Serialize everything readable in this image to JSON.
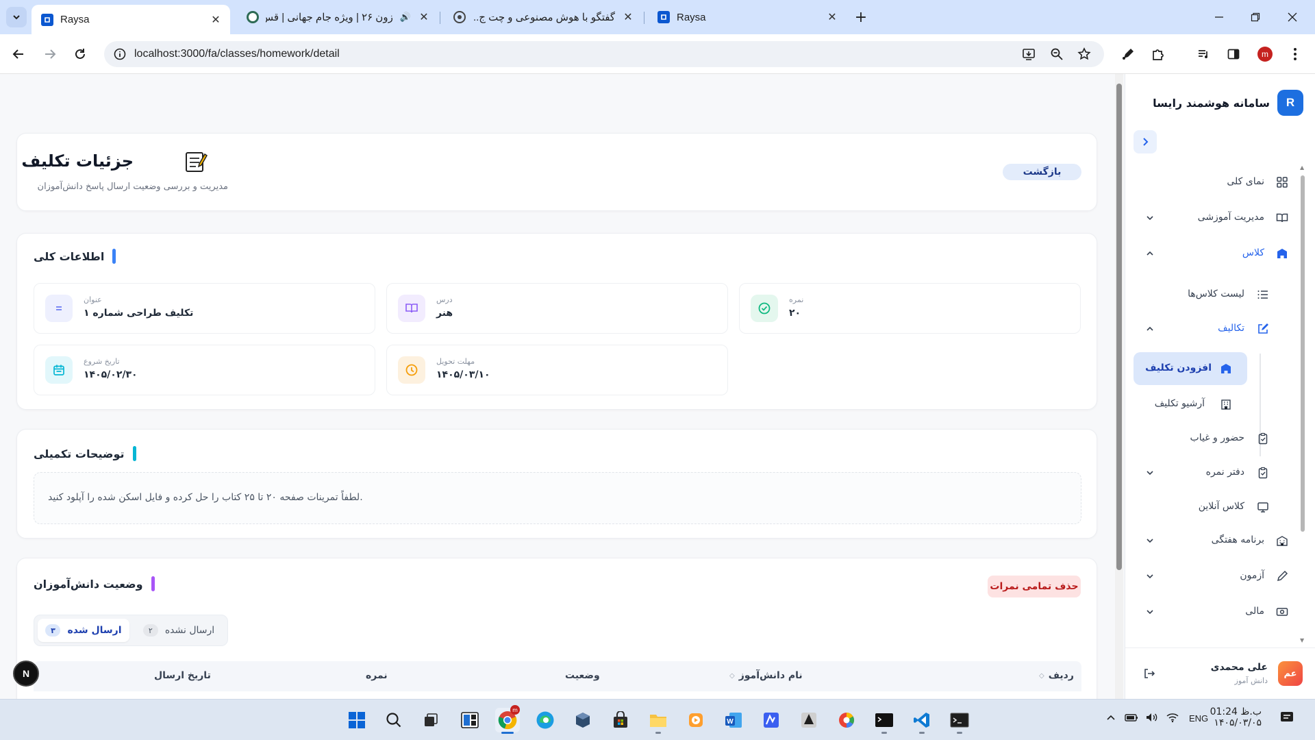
{
  "browser": {
    "tabs": [
      {
        "title": "Raysa",
        "active": true,
        "icon": "raysa-favicon"
      },
      {
        "title": "زون ۲۶ | ویژه جام جهانی | قس...",
        "active": false,
        "icon": "site-favicon",
        "audio": true
      },
      {
        "title": "گفتگو با هوش مصنوعی و چت ج...",
        "active": false,
        "icon": "chatgpt-favicon"
      },
      {
        "title": "Raysa",
        "active": false,
        "icon": "raysa-favicon"
      }
    ],
    "url": "localhost:3000/fa/classes/homework/detail",
    "profile_initial": "m"
  },
  "header": {
    "title": "جزئیات تکلیف",
    "subtitle": "مدیریت و بررسی وضعیت ارسال پاسخ دانش‌آموزان",
    "back_label": "بازگشت"
  },
  "general_info": {
    "title": "اطلاعات کلی",
    "fields": [
      {
        "label": "عنوان",
        "value": "تکلیف طراحی شماره ۱",
        "icon": "text-lines-icon",
        "color": "#6d7bf2",
        "bg": "#eef0fe"
      },
      {
        "label": "درس",
        "value": "هنر",
        "icon": "book-icon",
        "color": "#8b5cf6",
        "bg": "#f2ecfe"
      },
      {
        "label": "نمره",
        "value": "۲۰",
        "icon": "check-circle-icon",
        "color": "#10b981",
        "bg": "#e4f7ee"
      },
      {
        "label": "تاریخ شروع",
        "value": "۱۴۰۵/۰۲/۳۰",
        "icon": "calendar-icon",
        "color": "#06b6d4",
        "bg": "#e2f7fb"
      },
      {
        "label": "مهلت تحویل",
        "value": "۱۴۰۵/۰۳/۱۰",
        "icon": "clock-icon",
        "color": "#f59e0b",
        "bg": "#fdf1df"
      }
    ]
  },
  "extra": {
    "title": "توضیحات تکمیلی",
    "text": "لطفاً تمرینات صفحه ۲۰ تا ۲۵ کتاب را حل کرده و فایل اسکن شده را آپلود کنید."
  },
  "students": {
    "title": "وضعیت دانش‌آموزان",
    "delete_all_label": "حذف تمامی نمرات",
    "tabs": [
      {
        "label": "ارسال شده",
        "count": "۳",
        "active": true
      },
      {
        "label": "ارسال نشده",
        "count": "۲",
        "active": false
      }
    ],
    "columns": [
      "ردیف",
      "نام دانش‌آموز",
      "وضعیت",
      "نمره",
      "تاریخ ارسال"
    ]
  },
  "sidebar": {
    "brand": "سامانه هوشمند رایسا",
    "logo_letter": "R",
    "items": [
      {
        "label": "نمای کلی",
        "icon": "grid-icon"
      },
      {
        "label": "مدیریت آموزشی",
        "icon": "book-open-icon",
        "expandable": true
      },
      {
        "label": "کلاس",
        "icon": "school-icon",
        "expanded": true,
        "highlight": true
      },
      {
        "label": "لیست کلاس‌ها",
        "icon": "list-icon"
      },
      {
        "label": "تکالیف",
        "icon": "edit-icon",
        "expanded": true,
        "highlight": true
      },
      {
        "label": "افزودن تکلیف",
        "icon": "school-icon",
        "active": true
      },
      {
        "label": "آرشیو تکلیف",
        "icon": "archive-building-icon"
      },
      {
        "label": "حضور و غیاب",
        "icon": "clipboard-icon"
      },
      {
        "label": "دفتر نمره",
        "icon": "clipboard-icon",
        "expandable": true
      },
      {
        "label": "کلاس آنلاین",
        "icon": "monitor-icon"
      },
      {
        "label": "برنامه هفتگی",
        "icon": "building-icon",
        "expandable": true
      },
      {
        "label": "آزمون",
        "icon": "pencil-icon",
        "expandable": true
      },
      {
        "label": "مالی",
        "icon": "money-icon",
        "expandable": true
      }
    ],
    "user": {
      "initials": "عم",
      "name": "علی محمدی",
      "role": "دانش آموز"
    }
  },
  "taskbar": {
    "language": "ENG",
    "time": "ب.ظ 01:24",
    "date": "۱۴۰۵/۰۳/۰۵"
  },
  "colors": {
    "primary": "#1d6fe0",
    "accent_blue": "#2563eb",
    "danger": "#b91c1c"
  }
}
